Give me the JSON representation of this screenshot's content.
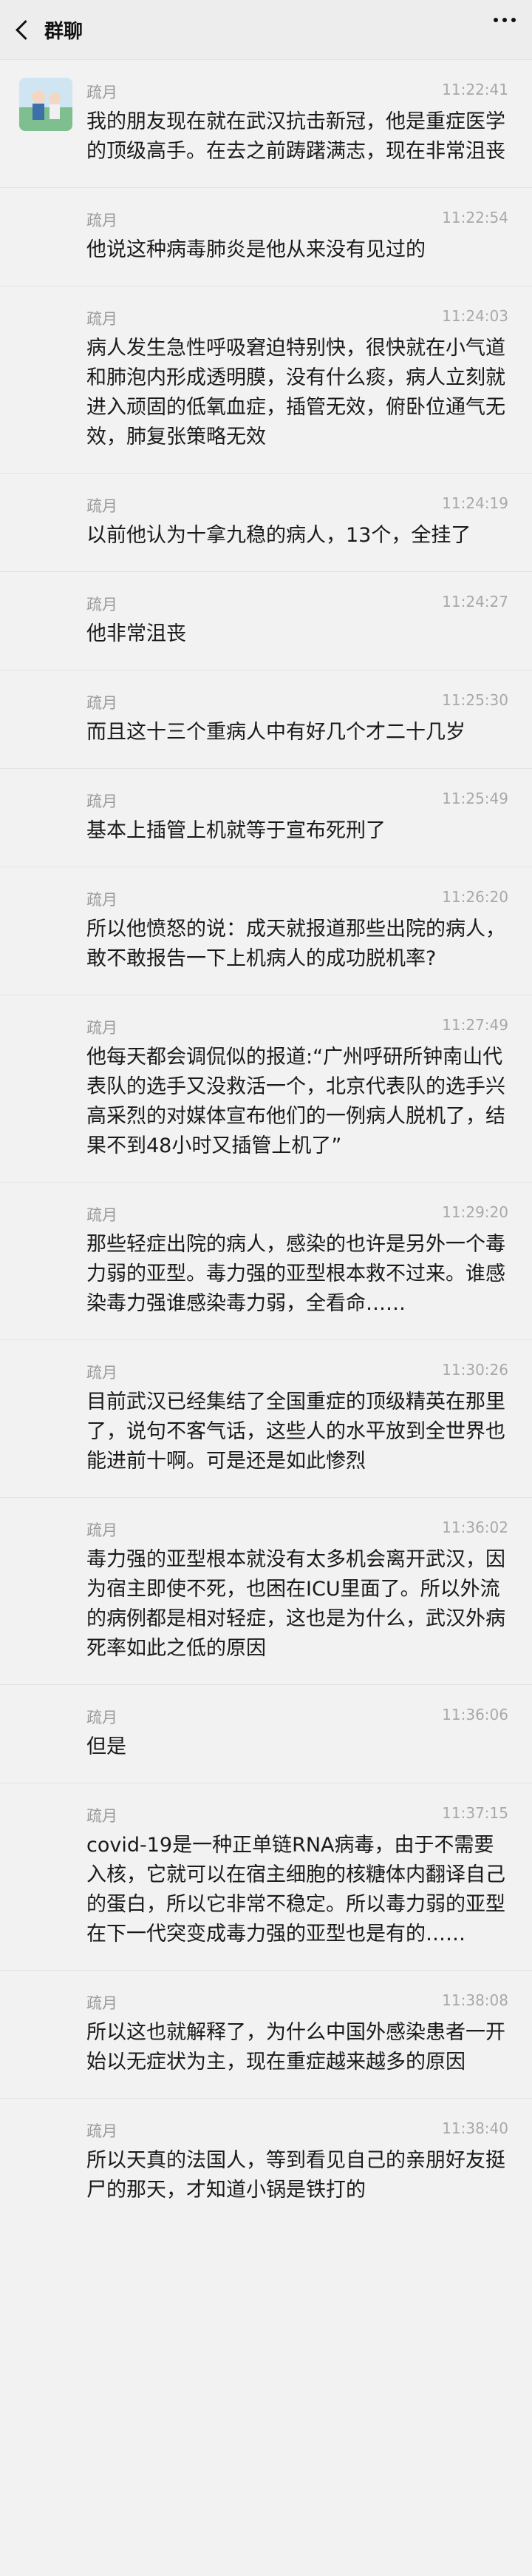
{
  "header": {
    "title": "群聊"
  },
  "messages": [
    {
      "sender": "疏月",
      "time": "11:22:41",
      "text": "我的朋友现在就在武汉抗击新冠，他是重症医学的顶级高手。在去之前踌躇满志，现在非常沮丧"
    },
    {
      "sender": "疏月",
      "time": "11:22:54",
      "text": "他说这种病毒肺炎是他从来没有见过的"
    },
    {
      "sender": "疏月",
      "time": "11:24:03",
      "text": "病人发生急性呼吸窘迫特别快，很快就在小气道和肺泡内形成透明膜，没有什么痰，病人立刻就进入顽固的低氧血症，插管无效，俯卧位通气无效，肺复张策略无效"
    },
    {
      "sender": "疏月",
      "time": "11:24:19",
      "text": "以前他认为十拿九稳的病人，13个，全挂了"
    },
    {
      "sender": "疏月",
      "time": "11:24:27",
      "text": "他非常沮丧"
    },
    {
      "sender": "疏月",
      "time": "11:25:30",
      "text": "而且这十三个重病人中有好几个才二十几岁"
    },
    {
      "sender": "疏月",
      "time": "11:25:49",
      "text": "基本上插管上机就等于宣布死刑了"
    },
    {
      "sender": "疏月",
      "time": "11:26:20",
      "text": "所以他愤怒的说：成天就报道那些出院的病人，敢不敢报告一下上机病人的成功脱机率?"
    },
    {
      "sender": "疏月",
      "time": "11:27:49",
      "text": "他每天都会调侃似的报道:“广州呼研所钟南山代表队的选手又没救活一个，北京代表队的选手兴高采烈的对媒体宣布他们的一例病人脱机了，结果不到48小时又插管上机了”"
    },
    {
      "sender": "疏月",
      "time": "11:29:20",
      "text": "那些轻症出院的病人，感染的也许是另外一个毒力弱的亚型。毒力强的亚型根本救不过来。谁感染毒力强谁感染毒力弱，全看命……"
    },
    {
      "sender": "疏月",
      "time": "11:30:26",
      "text": "目前武汉已经集结了全国重症的顶级精英在那里了，说句不客气话，这些人的水平放到全世界也能进前十啊。可是还是如此惨烈"
    },
    {
      "sender": "疏月",
      "time": "11:36:02",
      "text": "毒力强的亚型根本就没有太多机会离开武汉，因为宿主即使不死，也困在ICU里面了。所以外流的病例都是相对轻症，这也是为什么，武汉外病死率如此之低的原因"
    },
    {
      "sender": "疏月",
      "time": "11:36:06",
      "text": "但是"
    },
    {
      "sender": "疏月",
      "time": "11:37:15",
      "text": "covid-19是一种正单链RNA病毒，由于不需要入核，它就可以在宿主细胞的核糖体内翻译自己的蛋白，所以它非常不稳定。所以毒力弱的亚型在下一代突变成毒力强的亚型也是有的……"
    },
    {
      "sender": "疏月",
      "time": "11:38:08",
      "text": "所以这也就解释了，为什么中国外感染患者一开始以无症状为主，现在重症越来越多的原因"
    },
    {
      "sender": "疏月",
      "time": "11:38:40",
      "text": "所以天真的法国人，等到看见自己的亲朋好友挺尸的那天，才知道小锅是铁打的"
    }
  ]
}
